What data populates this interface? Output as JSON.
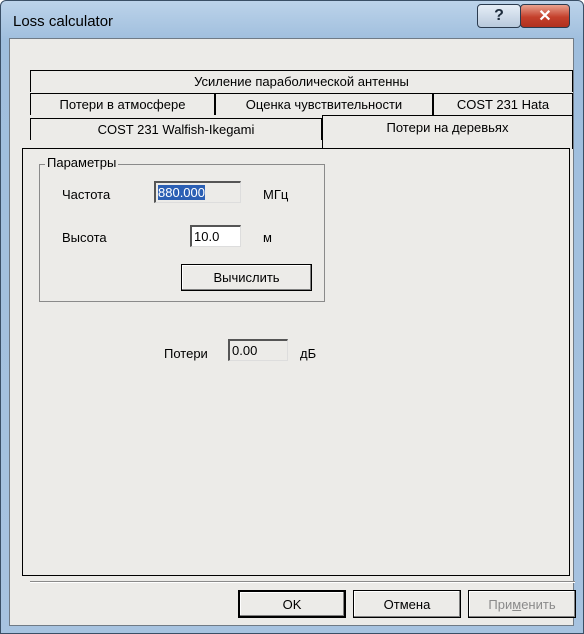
{
  "window": {
    "title": "Loss calculator",
    "help_glyph": "?",
    "close_glyph": "✕"
  },
  "tabs": {
    "row1": [
      {
        "label": "Усиление параболической антенны"
      }
    ],
    "row2": [
      {
        "label": "Потери в атмосфере"
      },
      {
        "label": "Оценка чувствительности"
      },
      {
        "label": "COST 231 Hata"
      }
    ],
    "row3": [
      {
        "label": "COST 231 Walfish-Ikegami"
      },
      {
        "label": "Потери на деревьях",
        "selected": true
      }
    ]
  },
  "params": {
    "group_label": "Параметры",
    "frequency_label": "Частота",
    "frequency_value": "880.000",
    "frequency_unit": "МГц",
    "height_label": "Высота",
    "height_value": "10.0",
    "height_unit": "м",
    "calc_button": "Вычислить"
  },
  "result": {
    "loss_label": "Потери",
    "loss_value": "0.00",
    "loss_unit": "дБ"
  },
  "buttons": {
    "ok": "OK",
    "cancel": "Отмена",
    "apply_prefix": "При",
    "apply_mnemonic": "м",
    "apply_suffix": "енить"
  }
}
